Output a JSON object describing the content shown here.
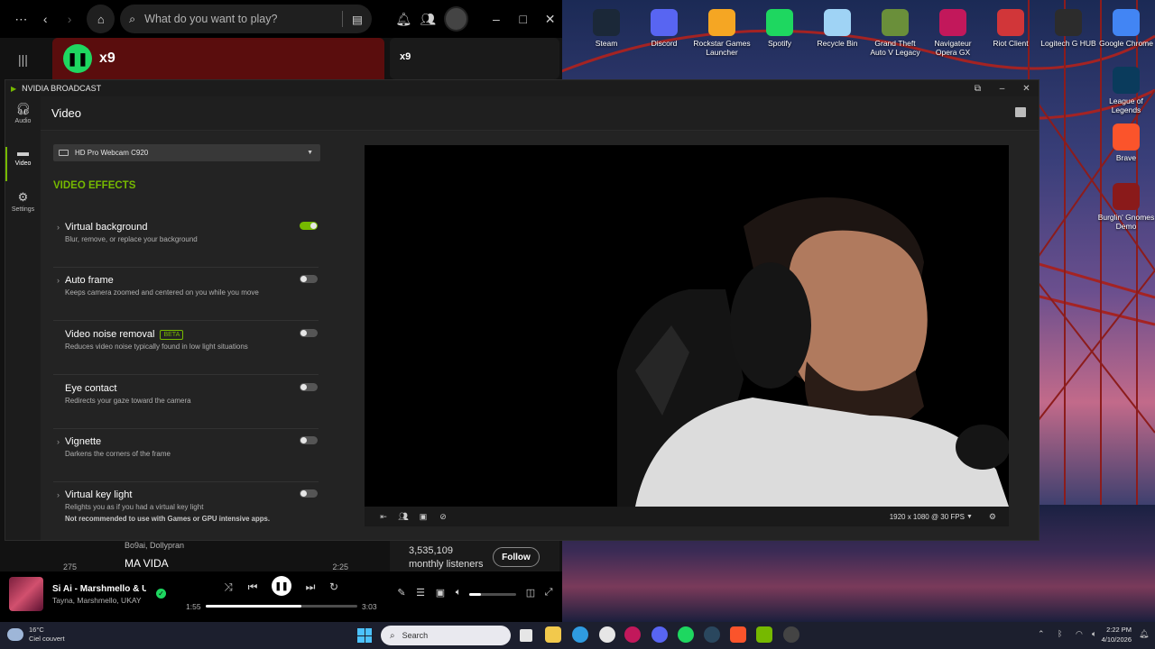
{
  "spotify": {
    "search_placeholder": "What do you want to play?",
    "banner_count": "x9",
    "side_count": "x9",
    "list": {
      "row1_artists": "Bo9ai, Dollypran",
      "row2_number": "275",
      "row2_title": "MA VIDA",
      "row2_duration": "2:25"
    },
    "artist": {
      "listeners_count": "3,535,109",
      "listeners_label": "monthly listeners",
      "follow_label": "Follow"
    },
    "player": {
      "title": "Si Ai - Marshmello & Ukay",
      "artists": "Tayna, Marshmello, UKAY",
      "elapsed": "1:55",
      "total": "3:03",
      "progress_fraction": 0.63,
      "volume_fraction": 0.25
    }
  },
  "desktop_icons": [
    {
      "label": "Steam",
      "icon": "steam-icon",
      "color": "#1b2838"
    },
    {
      "label": "Discord",
      "icon": "discord-icon",
      "color": "#5865f2"
    },
    {
      "label": "Rockstar Games Launcher",
      "icon": "rockstar-icon",
      "color": "#f5a623"
    },
    {
      "label": "Spotify",
      "icon": "spotify-icon",
      "color": "#1ed760"
    },
    {
      "label": "Recycle Bin",
      "icon": "recycle-bin-icon",
      "color": "#9fd3f5"
    },
    {
      "label": "Grand Theft Auto V Legacy",
      "icon": "gta-icon",
      "color": "#6a8f3a"
    },
    {
      "label": "Navigateur Opera GX",
      "icon": "opera-gx-icon",
      "color": "#c2185b"
    },
    {
      "label": "Riot Client",
      "icon": "riot-icon",
      "color": "#d13639"
    },
    {
      "label": "Logitech G HUB",
      "icon": "logitech-icon",
      "color": "#2c2c2c"
    },
    {
      "label": "Google Chrome",
      "icon": "chrome-icon",
      "color": "#4285f4"
    },
    {
      "label": "League of Legends",
      "icon": "league-icon",
      "color": "#0a3b5c"
    },
    {
      "label": "Brave",
      "icon": "brave-icon",
      "color": "#fb542b"
    },
    {
      "label": "Burglin' Gnomes Demo",
      "icon": "gnome-icon",
      "color": "#8a1a1a"
    }
  ],
  "broadcast": {
    "app_title": "NVIDIA BROADCAST",
    "nav": {
      "audio": "Audio",
      "video": "Video",
      "settings": "Settings"
    },
    "page_title": "Video",
    "camera": "HD Pro Webcam C920",
    "section_title": "VIDEO EFFECTS",
    "effects": [
      {
        "name": "Virtual background",
        "desc": "Blur, remove, or replace your background",
        "enabled": true,
        "expandable": true,
        "beta": ""
      },
      {
        "name": "Auto frame",
        "desc": "Keeps camera zoomed and centered on you while you move",
        "enabled": false,
        "expandable": true,
        "beta": ""
      },
      {
        "name": "Video noise removal",
        "desc": "Reduces video noise typically found in low light situations",
        "enabled": false,
        "expandable": false,
        "beta": "BETA"
      },
      {
        "name": "Eye contact",
        "desc": "Redirects your gaze toward the camera",
        "enabled": false,
        "expandable": false,
        "beta": ""
      },
      {
        "name": "Vignette",
        "desc": "Darkens the corners of the frame",
        "enabled": false,
        "expandable": true,
        "beta": ""
      },
      {
        "name": "Virtual key light",
        "desc": "Relights you as if you had a virtual key light",
        "enabled": false,
        "expandable": true,
        "beta": ""
      }
    ],
    "note": "Not recommended to use with Games or GPU intensive apps.",
    "resolution": "1920 x 1080 @ 30 FPS",
    "accent": "#76b900"
  },
  "taskbar": {
    "temperature": "16°C",
    "weather": "Ciel couvert",
    "search_placeholder": "Search",
    "time": "2:22 PM",
    "date": "4/10/2026"
  }
}
